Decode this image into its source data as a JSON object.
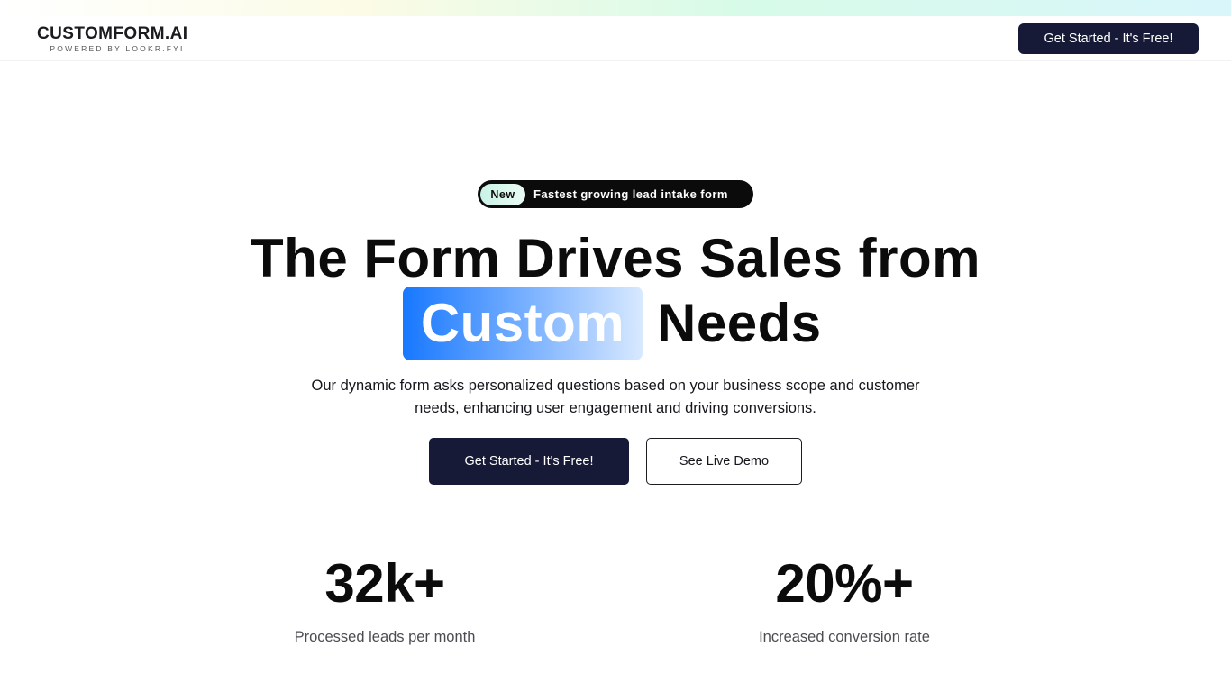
{
  "header": {
    "logo_title": "CUSTOMFORM.AI",
    "logo_subtitle": "POWERED BY LOOKR.FYI",
    "cta_label": "Get Started - It's Free!"
  },
  "badge": {
    "pill": "New",
    "text": "Fastest growing lead intake form"
  },
  "hero": {
    "line1": "The Form Drives Sales from",
    "highlight": "Custom",
    "line2_rest": "Needs",
    "subtext": "Our dynamic form asks personalized questions based on your business scope and customer needs, enhancing user engagement and driving conversions.",
    "primary_cta": "Get Started - It's Free!",
    "secondary_cta": "See Live Demo"
  },
  "stats": [
    {
      "value": "32k+",
      "label": "Processed leads per month"
    },
    {
      "value": "20%+",
      "label": "Increased conversion rate"
    }
  ],
  "colors": {
    "navy": "#161a36",
    "highlight_blue": "#1878ff",
    "badge_bg": "#0b0b0b",
    "badge_pill": "#c9f2e6"
  }
}
